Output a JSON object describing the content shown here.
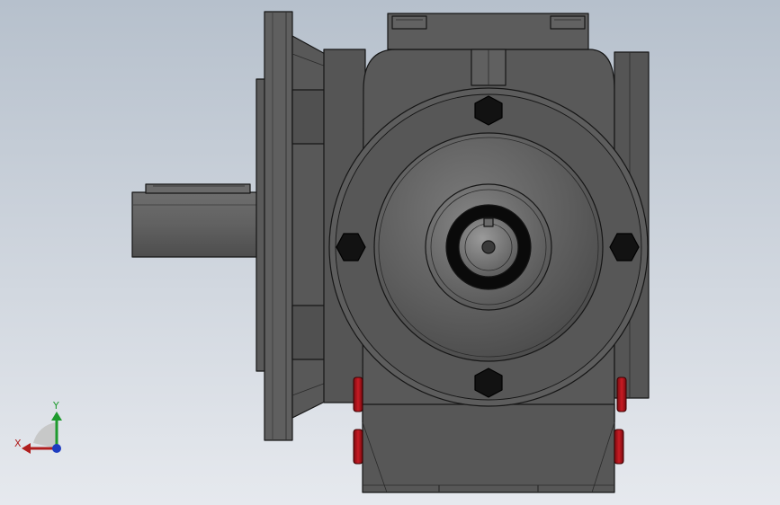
{
  "viewport": {
    "background_top": "#b6c0cc",
    "background_bottom": "#e6e9ee",
    "part_color": "#5b5b5b",
    "edge_color": "#161616",
    "accent_red": "#b8141c"
  },
  "triad": {
    "x_label": "X",
    "y_label": "Y",
    "x_color": "#b01e1e",
    "y_color": "#1e9a2e",
    "z_color": "#1e3cc0"
  }
}
